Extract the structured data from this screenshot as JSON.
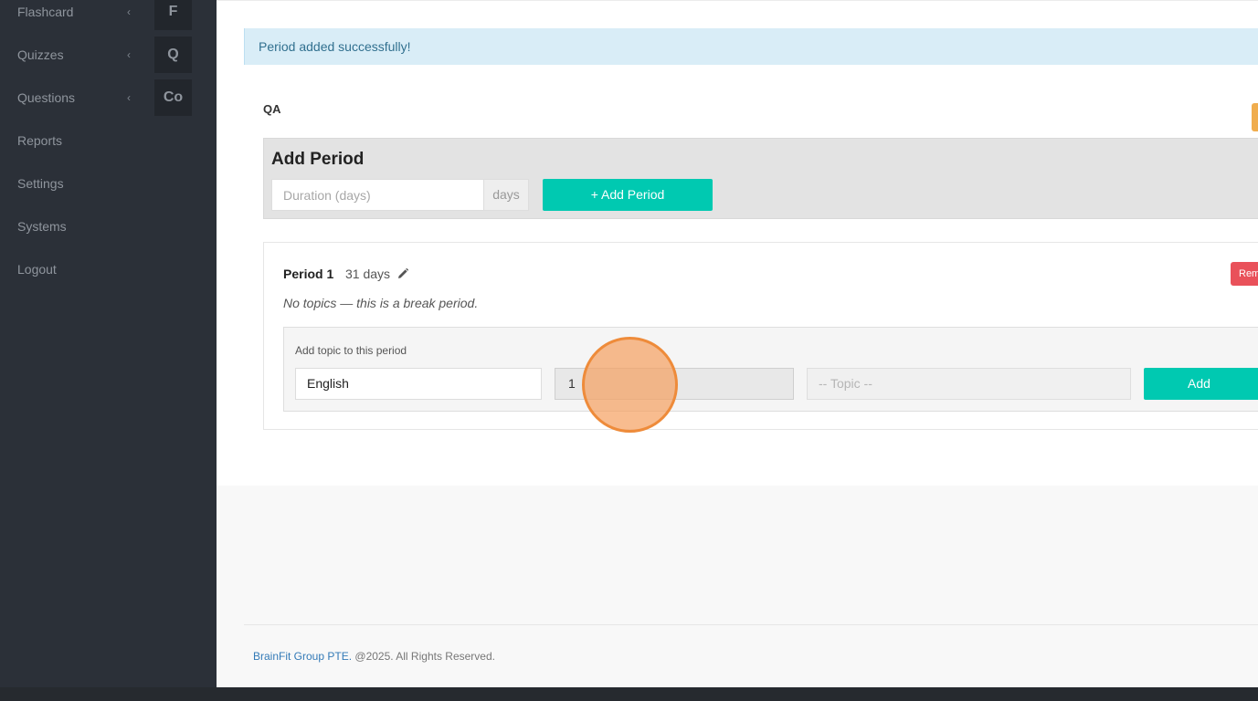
{
  "sidebar": {
    "items": [
      {
        "label": "Flashcard",
        "badge": "F",
        "has_chevron": true
      },
      {
        "label": "Quizzes",
        "badge": "Q",
        "has_chevron": true
      },
      {
        "label": "Questions",
        "badge": "Co",
        "has_chevron": true
      },
      {
        "label": "Reports"
      },
      {
        "label": "Settings"
      },
      {
        "label": "Systems"
      },
      {
        "label": "Logout"
      }
    ],
    "chevron_glyph": "‹"
  },
  "alert": {
    "message": "Period added successfully!"
  },
  "page": {
    "title": "QA"
  },
  "add_period": {
    "heading": "Add Period",
    "duration_placeholder": "Duration (days)",
    "days_addon": "days",
    "button_label": "+ Add Period"
  },
  "period": {
    "name": "Period 1",
    "days": "31 days",
    "remove_label": "Remove",
    "break_note": "No topics — this is a break period.",
    "add_topic": {
      "label": "Add topic to this period",
      "subject_value": "English",
      "level_value": "1",
      "topic_placeholder": "-- Topic --",
      "add_label": "Add"
    }
  },
  "footer": {
    "company": "BrainFit Group PTE.",
    "rights": " @2025. All Rights Reserved."
  },
  "colors": {
    "sidebar_bg": "#2b3038",
    "accent_teal": "#00c9b1",
    "alert_bg": "#d9edf7",
    "danger": "#e9515a",
    "warning": "#f0ad4e"
  }
}
